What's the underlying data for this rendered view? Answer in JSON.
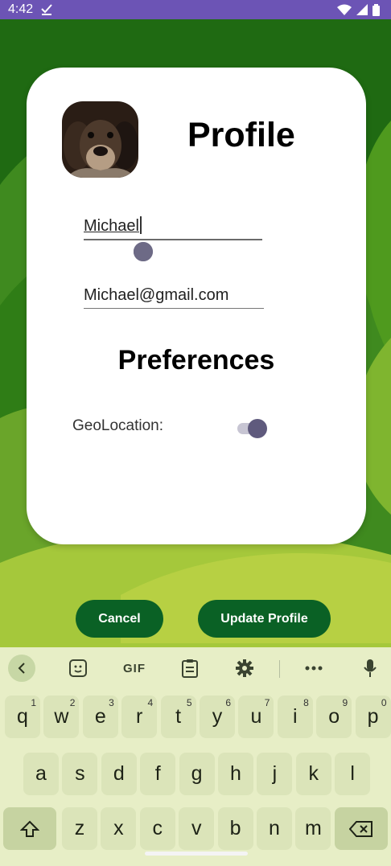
{
  "status_bar": {
    "time": "4:42",
    "icons": [
      "check-icon",
      "wifi-icon",
      "signal-icon",
      "battery-icon"
    ]
  },
  "profile": {
    "title": "Profile",
    "name_value": "Michael",
    "email_value": "Michael@gmail.com"
  },
  "preferences": {
    "title": "Preferences",
    "geolocation_label": "GeoLocation:",
    "geolocation_enabled": true
  },
  "buttons": {
    "cancel_label": "Cancel",
    "update_label": "Update Profile"
  },
  "keyboard": {
    "toolbar": [
      "back-icon",
      "sticker-icon",
      "gif-icon",
      "clipboard-icon",
      "settings-icon",
      "more-icon",
      "mic-icon"
    ],
    "gif_label": "GIF",
    "row1": [
      {
        "k": "q",
        "h": "1"
      },
      {
        "k": "w",
        "h": "2"
      },
      {
        "k": "e",
        "h": "3"
      },
      {
        "k": "r",
        "h": "4"
      },
      {
        "k": "t",
        "h": "5"
      },
      {
        "k": "y",
        "h": "6"
      },
      {
        "k": "u",
        "h": "7"
      },
      {
        "k": "i",
        "h": "8"
      },
      {
        "k": "o",
        "h": "9"
      },
      {
        "k": "p",
        "h": "0"
      }
    ],
    "row2": [
      "a",
      "s",
      "d",
      "f",
      "g",
      "h",
      "j",
      "k",
      "l"
    ],
    "row3": [
      "z",
      "x",
      "c",
      "v",
      "b",
      "n",
      "m"
    ]
  },
  "colors": {
    "status_bar": "#6c54b5",
    "button": "#0a6125",
    "keyboard_bg": "#e7eec6",
    "key_bg": "#dbe4b9"
  }
}
